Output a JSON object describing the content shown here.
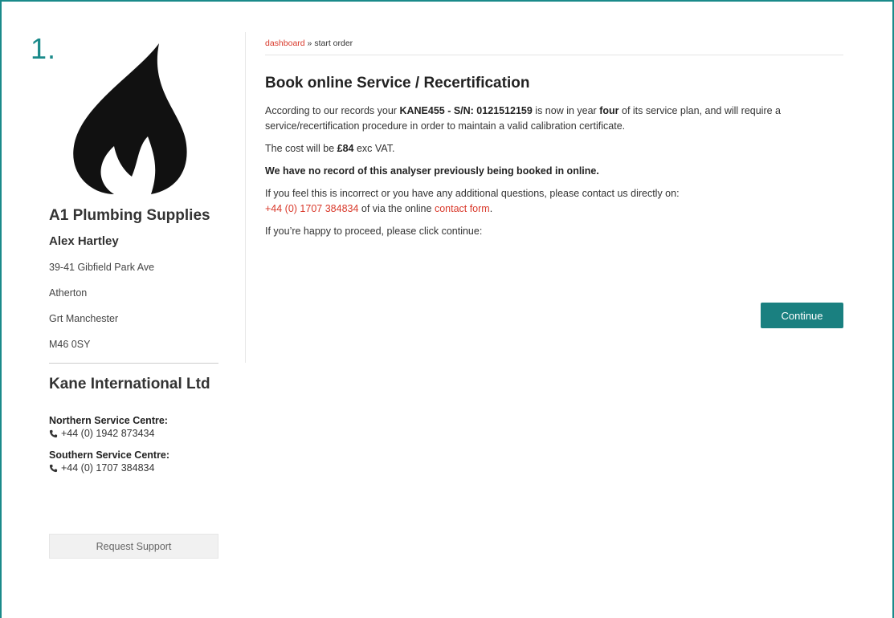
{
  "step_number": "1.",
  "sidebar": {
    "company": "A1 Plumbing Supplies",
    "contact": "Alex Hartley",
    "address": [
      "39-41 Gibfield Park Ave",
      "Atherton",
      "Grt Manchester",
      "M46 0SY"
    ],
    "vendor": "Kane International Ltd",
    "centres": [
      {
        "title": "Northern Service Centre:",
        "phone": "+44 (0) 1942 873434"
      },
      {
        "title": "Southern Service Centre:",
        "phone": "+44 (0) 1707 384834"
      }
    ],
    "support_button": "Request Support"
  },
  "breadcrumb": {
    "link": "dashboard",
    "separator": " » ",
    "current": "start order"
  },
  "main": {
    "title": "Book online Service / Recertification",
    "p1_pre": "According to our records your ",
    "p1_model": "KANE455 - S/N: 0121512159",
    "p1_mid": " is now in year ",
    "p1_year": "four",
    "p1_post": " of its service plan, and will require a service/recertification procedure in order to maintain a valid calibration certificate.",
    "p2_pre": "The cost will be ",
    "p2_price": "£84",
    "p2_post": " exc VAT.",
    "p3": "We have no record of this analyser previously being booked in online.",
    "p4_line1": "If you feel this is incorrect or you have any additional questions, please contact us directly on:",
    "p4_phone": "+44 (0) 1707 384834",
    "p4_mid": " of via the online ",
    "p4_link": "contact form",
    "p4_end": ".",
    "p5": "If you’re happy to proceed, please click continue:",
    "continue_label": "Continue"
  },
  "colors": {
    "accent": "#1a8080",
    "link": "#d9392b"
  }
}
